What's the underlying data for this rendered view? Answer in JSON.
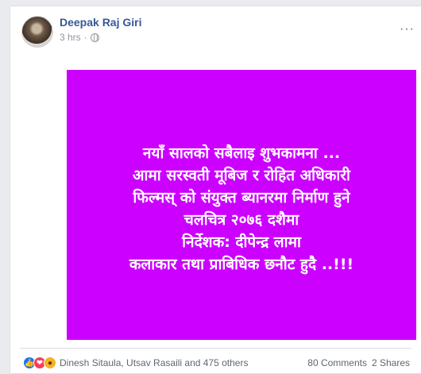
{
  "post": {
    "author": "Deepak Raj Giri",
    "time": "3 hrs",
    "separator": "·",
    "more_label": "···"
  },
  "image": {
    "background": "#cc00ff",
    "text_color": "#ffffff",
    "lines": [
      "नयाँ सालको सबैलाइ शुभकामना ...",
      "आमा सरस्वती मूबिज र रोहित अधिकारी",
      "फिल्मस् को संयुक्त ब्यानरमा निर्माण हुने",
      "चलचित्र २०७६ दशैमा",
      "निर्देशक: दीपेन्द्र लामा",
      "कलाकार तथा प्राबिधिक छनौट हुदै ..!!!"
    ]
  },
  "footer": {
    "reactions": [
      "like-icon",
      "love-icon",
      "wow-icon"
    ],
    "reactors": "Dinesh Sitaula, Utsav Rasaili and 475 others",
    "comments": "80 Comments",
    "shares": "2 Shares"
  }
}
